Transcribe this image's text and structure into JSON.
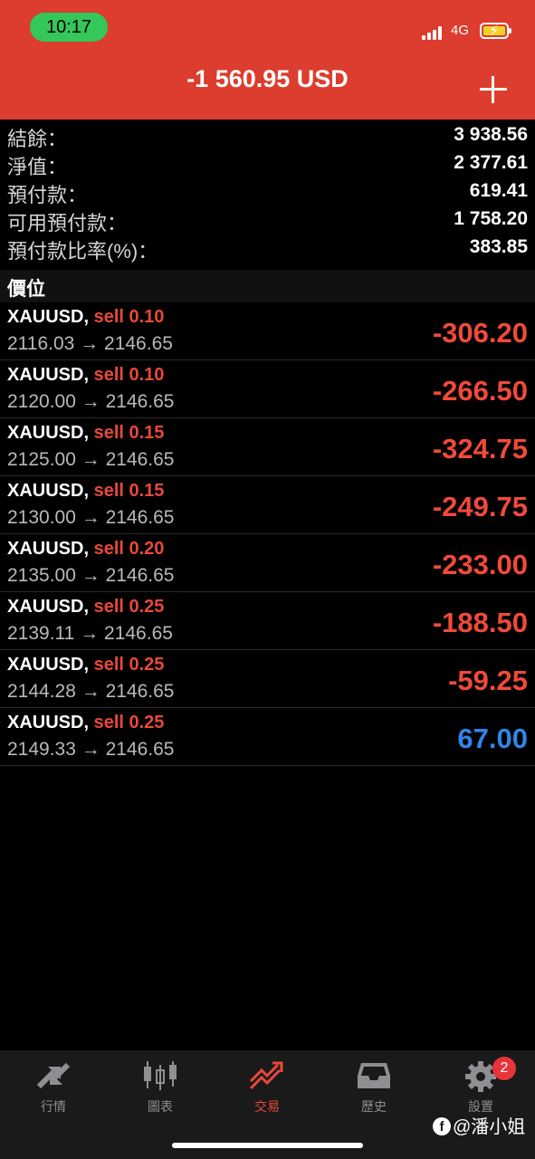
{
  "status_bar": {
    "time": "10:17",
    "network": "4G"
  },
  "header": {
    "title": "-1 560.95 USD"
  },
  "summary": [
    {
      "label": "結餘：",
      "value": "3 938.56"
    },
    {
      "label": "淨值：",
      "value": "2 377.61"
    },
    {
      "label": "預付款：",
      "value": "619.41"
    },
    {
      "label": "可用預付款：",
      "value": "1 758.20"
    },
    {
      "label": "預付款比率(%)：",
      "value": "383.85"
    }
  ],
  "section_title": "價位",
  "positions": [
    {
      "symbol": "XAUUSD,",
      "side": "sell 0.10",
      "prices": "2116.03 → 2146.65",
      "profit": "-306.20",
      "sign": "neg"
    },
    {
      "symbol": "XAUUSD,",
      "side": "sell 0.10",
      "prices": "2120.00 → 2146.65",
      "profit": "-266.50",
      "sign": "neg"
    },
    {
      "symbol": "XAUUSD,",
      "side": "sell 0.15",
      "prices": "2125.00 → 2146.65",
      "profit": "-324.75",
      "sign": "neg"
    },
    {
      "symbol": "XAUUSD,",
      "side": "sell 0.15",
      "prices": "2130.00 → 2146.65",
      "profit": "-249.75",
      "sign": "neg"
    },
    {
      "symbol": "XAUUSD,",
      "side": "sell 0.20",
      "prices": "2135.00 → 2146.65",
      "profit": "-233.00",
      "sign": "neg"
    },
    {
      "symbol": "XAUUSD,",
      "side": "sell 0.25",
      "prices": "2139.11 → 2146.65",
      "profit": "-188.50",
      "sign": "neg"
    },
    {
      "symbol": "XAUUSD,",
      "side": "sell 0.25",
      "prices": "2144.28 → 2146.65",
      "profit": "-59.25",
      "sign": "neg"
    },
    {
      "symbol": "XAUUSD,",
      "side": "sell 0.25",
      "prices": "2149.33 → 2146.65",
      "profit": "67.00",
      "sign": "pos"
    }
  ],
  "tabs": [
    {
      "label": "行情",
      "icon": "quotes-arrows-icon"
    },
    {
      "label": "圖表",
      "icon": "candlestick-icon"
    },
    {
      "label": "交易",
      "icon": "trade-trend-icon",
      "active": true
    },
    {
      "label": "歷史",
      "icon": "inbox-tray-icon"
    },
    {
      "label": "設置",
      "icon": "gear-icon",
      "badge": "2"
    }
  ],
  "watermark": "@潘小姐",
  "colors": {
    "header": "#dc3d2e",
    "loss": "#f04a3a",
    "gain": "#2e86e8",
    "active_tab": "#e8483a"
  }
}
